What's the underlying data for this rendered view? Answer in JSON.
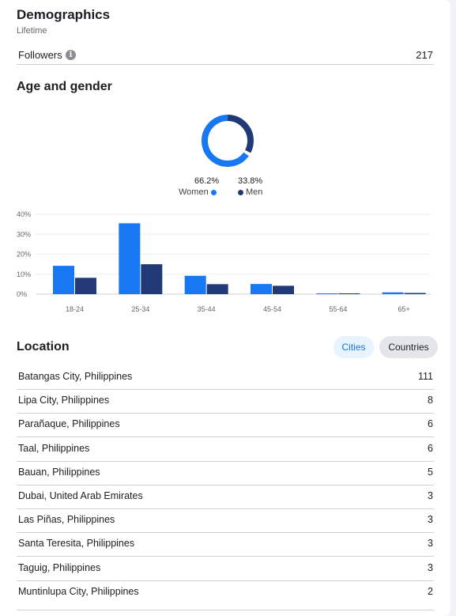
{
  "demographics": {
    "title": "Demographics",
    "subtitle": "Lifetime"
  },
  "followers": {
    "label": "Followers",
    "value": "217",
    "info_icon": "info-icon"
  },
  "age_gender": {
    "title": "Age and gender",
    "women_pct": "66.2%",
    "men_pct": "33.8%",
    "women_label": "Women",
    "men_label": "Men",
    "women_fraction": 0.662,
    "colors": {
      "women": "#1877f2",
      "men": "#213a77"
    }
  },
  "chart_data": {
    "type": "bar",
    "categories": [
      "18-24",
      "25-34",
      "35-44",
      "45-54",
      "55-64",
      "65+"
    ],
    "series": [
      {
        "name": "Women",
        "values": [
          14.2,
          35.5,
          9.2,
          5.1,
          0.4,
          0.9
        ]
      },
      {
        "name": "Men",
        "values": [
          8.2,
          15.0,
          5.0,
          4.2,
          0.4,
          0.6
        ]
      }
    ],
    "y_ticks": [
      "0%",
      "10%",
      "20%",
      "30%",
      "40%"
    ],
    "ylim": [
      0,
      40
    ],
    "grid": true
  },
  "location": {
    "title": "Location",
    "tabs": {
      "cities": "Cities",
      "countries": "Countries"
    },
    "rows": [
      {
        "name": "Batangas City, Philippines",
        "value": "111"
      },
      {
        "name": "Lipa City, Philippines",
        "value": "8"
      },
      {
        "name": "Parañaque, Philippines",
        "value": "6"
      },
      {
        "name": "Taal, Philippines",
        "value": "6"
      },
      {
        "name": "Bauan, Philippines",
        "value": "5"
      },
      {
        "name": "Dubai, United Arab Emirates",
        "value": "3"
      },
      {
        "name": "Las Piñas, Philippines",
        "value": "3"
      },
      {
        "name": "Santa Teresita, Philippines",
        "value": "3"
      },
      {
        "name": "Taguig, Philippines",
        "value": "3"
      },
      {
        "name": "Muntinlupa City, Philippines",
        "value": "2"
      }
    ]
  }
}
